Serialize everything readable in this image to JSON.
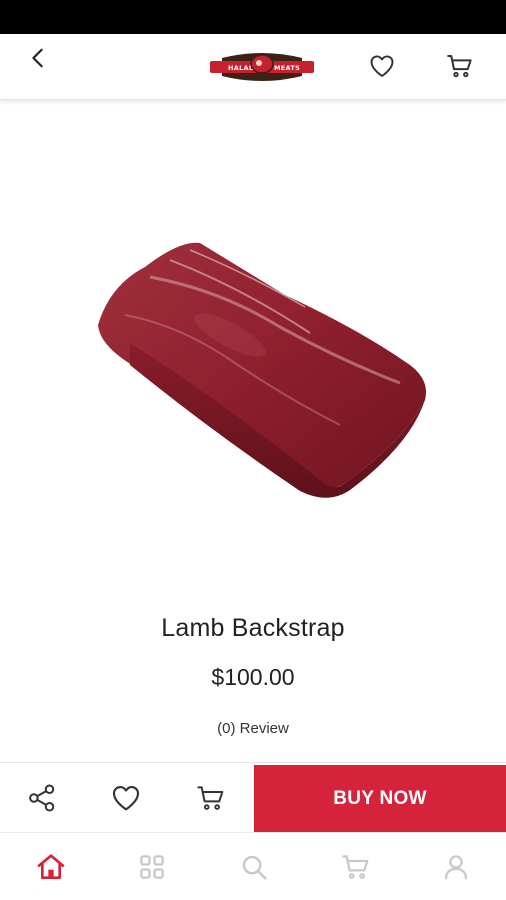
{
  "header": {
    "back_icon": "chevron-left-icon",
    "logo_left_text": "HALAL",
    "logo_right_text": "MEATS",
    "wishlist_icon": "heart-icon",
    "cart_icon": "cart-icon"
  },
  "product": {
    "image": "lamb-backstrap-meat-photo",
    "title": "Lamb Backstrap",
    "price": "$100.00",
    "review": "(0)  Review"
  },
  "actions": {
    "share_icon": "share-icon",
    "wishlist_icon": "heart-icon",
    "cart_icon": "cart-icon",
    "buy_now_label": "BUY NOW"
  },
  "bottom_nav": {
    "items": [
      {
        "icon": "home-icon",
        "active": true
      },
      {
        "icon": "categories-grid-icon",
        "active": false
      },
      {
        "icon": "search-icon",
        "active": false
      },
      {
        "icon": "cart-icon",
        "active": false
      },
      {
        "icon": "profile-icon",
        "active": false
      }
    ]
  },
  "colors": {
    "accent": "#d4233a",
    "icon_inactive": "#c8c8c8",
    "icon_default": "#333333",
    "text": "#222222"
  }
}
